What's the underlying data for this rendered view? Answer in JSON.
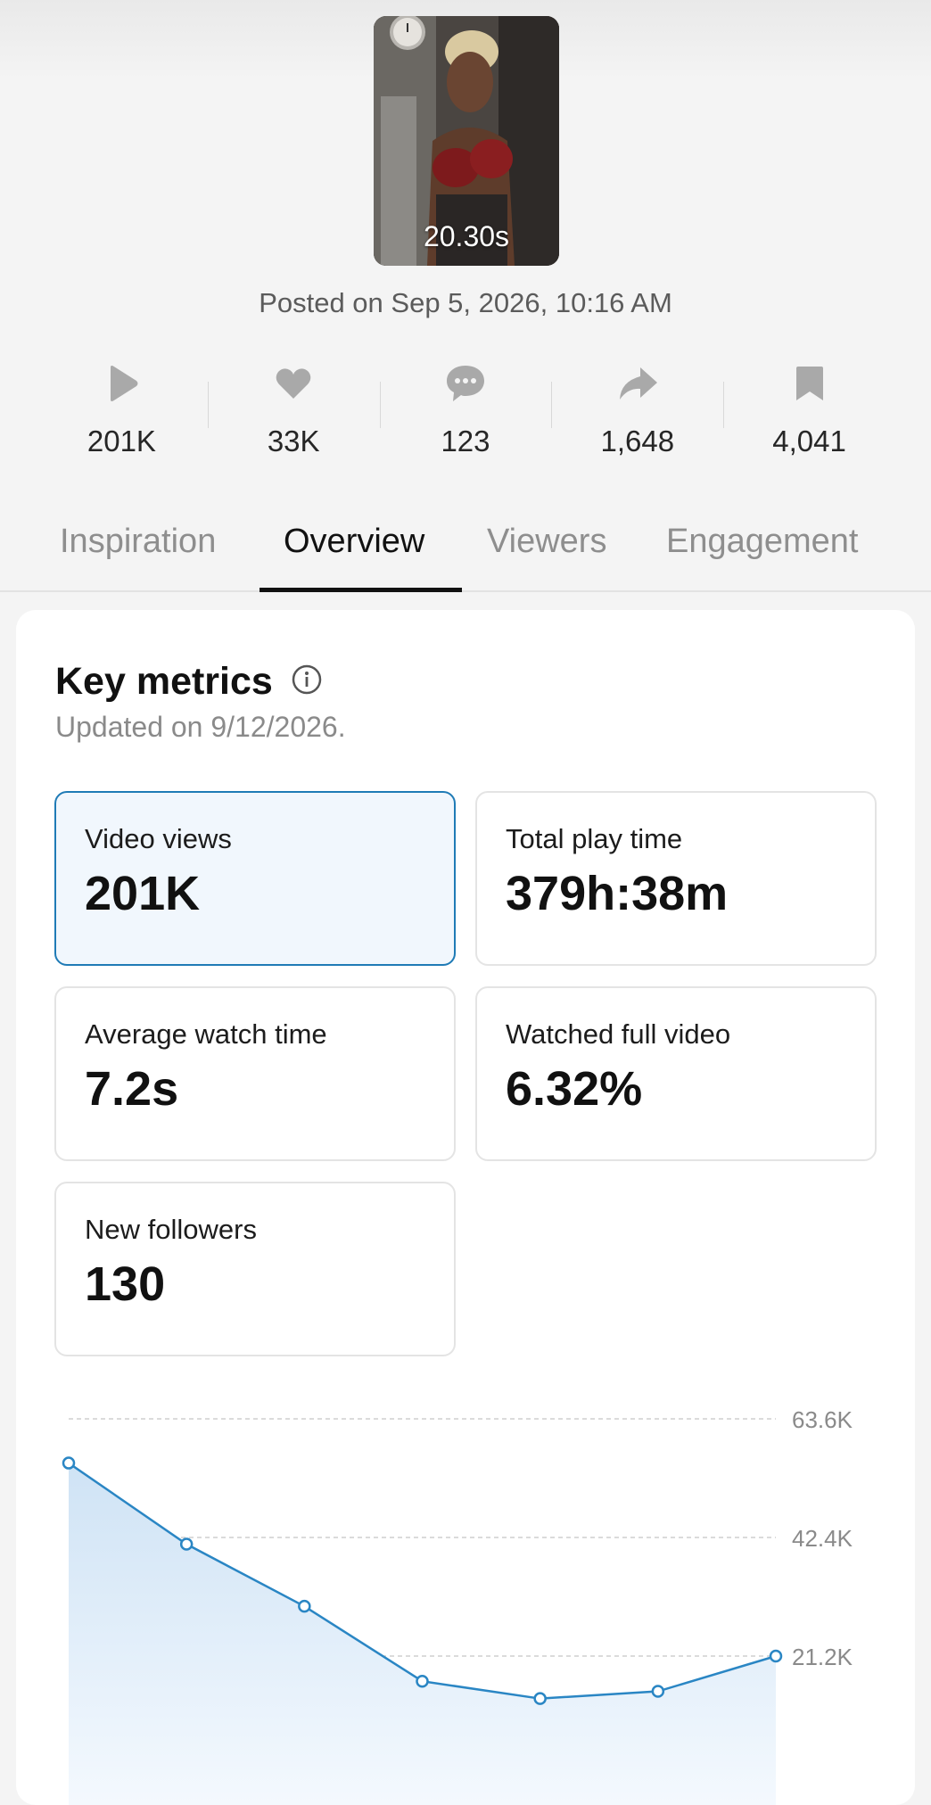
{
  "video": {
    "duration": "20.30s",
    "posted": "Posted on Sep 5, 2026, 10:16 AM"
  },
  "stats": [
    {
      "icon": "play-icon",
      "value": "201K"
    },
    {
      "icon": "heart-icon",
      "value": "33K"
    },
    {
      "icon": "comment-icon",
      "value": "123"
    },
    {
      "icon": "share-icon",
      "value": "1,648"
    },
    {
      "icon": "bookmark-icon",
      "value": "4,041"
    }
  ],
  "tabs": [
    {
      "label": "Inspiration",
      "active": false
    },
    {
      "label": "Overview",
      "active": true
    },
    {
      "label": "Viewers",
      "active": false
    },
    {
      "label": "Engagement",
      "active": false
    }
  ],
  "key_metrics": {
    "title": "Key metrics",
    "updated": "Updated on 9/12/2026.",
    "cards": [
      {
        "label": "Video views",
        "value": "201K",
        "selected": true
      },
      {
        "label": "Total play time",
        "value": "379h:38m",
        "selected": false
      },
      {
        "label": "Average watch time",
        "value": "7.2s",
        "selected": false
      },
      {
        "label": "Watched full video",
        "value": "6.32%",
        "selected": false
      },
      {
        "label": "New followers",
        "value": "130",
        "selected": false
      }
    ]
  },
  "colors": {
    "accent": "#1f7bb6",
    "selected_bg": "#f1f7fd",
    "line": "#2a86c4",
    "fill_top": "#cfe3f5"
  },
  "chart_data": {
    "type": "area",
    "y_tick_labels": [
      "63.6K",
      "42.4K",
      "21.2K"
    ],
    "y_ticks": [
      63600,
      42400,
      21200
    ],
    "ylim": [
      0,
      63600
    ],
    "grid": true,
    "series": [
      {
        "values": [
          55700,
          41200,
          30100,
          16700,
          13600,
          14900,
          21200
        ]
      }
    ]
  }
}
